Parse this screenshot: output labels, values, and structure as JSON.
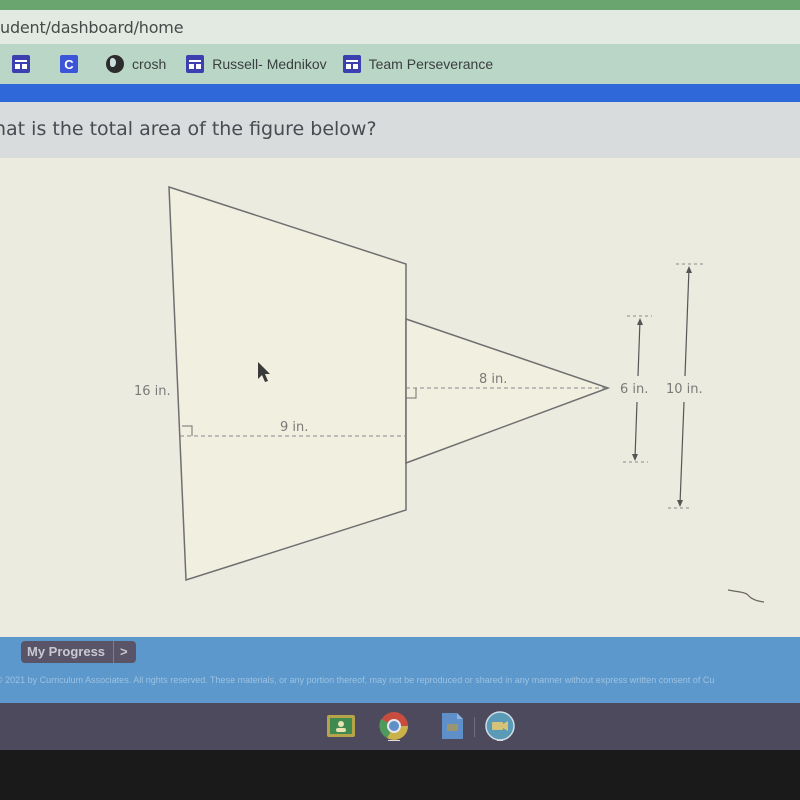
{
  "browser": {
    "url": "udent/dashboard/home",
    "bookmarks": [
      {
        "icon": "grid-app-icon",
        "label": ""
      },
      {
        "icon": "c-app-icon",
        "label": "",
        "glyph": "C"
      },
      {
        "icon": "globe-icon",
        "label": "crosh"
      },
      {
        "icon": "grid-app-icon",
        "label": "Russell- Mednikov"
      },
      {
        "icon": "grid-app-icon",
        "label": "Team Perseverance"
      }
    ]
  },
  "question": {
    "text": "hat is the total area of the figure below?"
  },
  "figure": {
    "labels": {
      "trapezoid_height": "16 in.",
      "trapezoid_width": "9 in.",
      "triangle_height": "8 in.",
      "triangle_base": "6 in.",
      "trapezoid_right_side": "10 in."
    },
    "colors": {
      "stroke": "#6f6f70",
      "dashed": "#8a8a8a",
      "fill": "#f1efdf"
    }
  },
  "calculator": {
    "keys": [
      "−",
      "×",
      "+",
      "="
    ]
  },
  "footer": {
    "my_progress_label": "My Progress",
    "my_progress_arrow": ">",
    "copyright": "© 2021 by Curriculum Associates. All rights reserved. These materials, or any portion thereof, may not be reproduced or shared in any manner without express written consent of Cu"
  },
  "shelf": {
    "apps": [
      {
        "name": "google-classroom",
        "color": "#b7a44a"
      },
      {
        "name": "chrome",
        "color": "#c94d3f"
      },
      {
        "name": "google-docs",
        "color": "#5e8fc8"
      },
      {
        "name": "google-meet",
        "color": "#5a9ab7"
      }
    ]
  }
}
